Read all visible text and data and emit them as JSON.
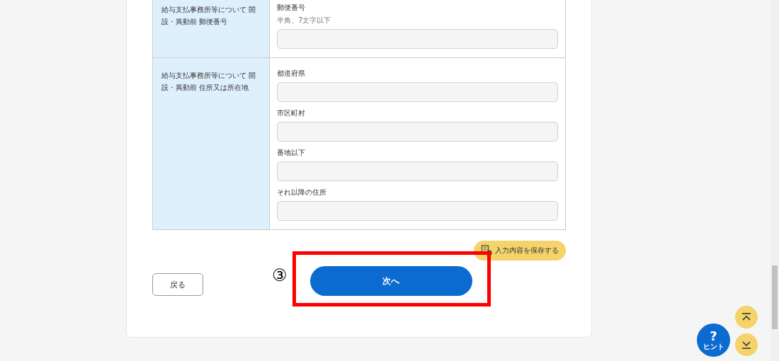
{
  "form_rows": [
    {
      "label": "給与支払事務所等について 開設・異動前 郵便番号",
      "fields": [
        {
          "label": "郵便番号",
          "hint": "半角、7文字以下"
        }
      ]
    },
    {
      "label": "給与支払事務所等について 開設・異動前 住所又は所在地",
      "fields": [
        {
          "label": "都道府県"
        },
        {
          "label": "市区町村"
        },
        {
          "label": "番地以下"
        },
        {
          "label": "それ以降の住所"
        }
      ]
    }
  ],
  "save_button": "入力内容を保存する",
  "back_button": "戻る",
  "annotation_marker": "③",
  "next_button": "次へ",
  "hint_button": {
    "symbol": "?",
    "label": "ヒント"
  }
}
